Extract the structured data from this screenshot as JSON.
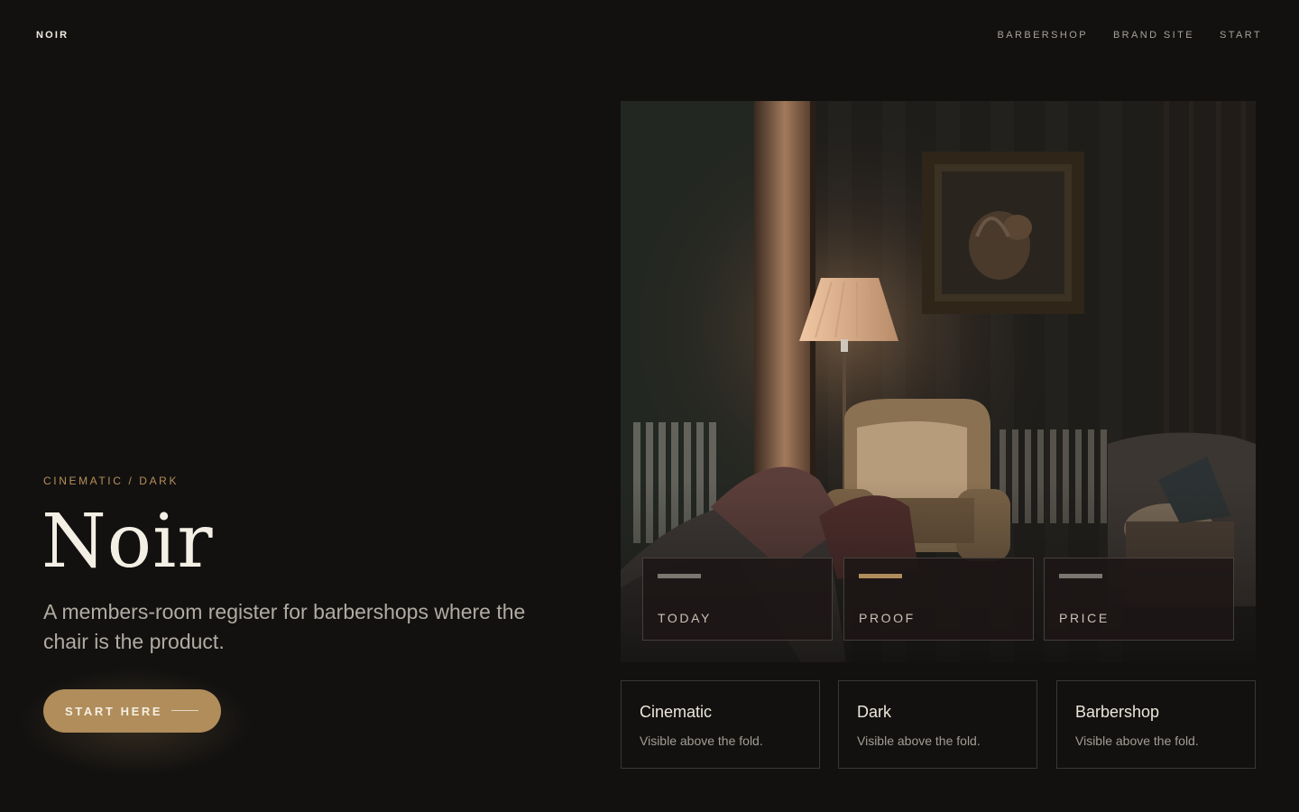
{
  "header": {
    "brand": "NOIR",
    "nav": [
      "BARBERSHOP",
      "BRAND SITE",
      "START"
    ]
  },
  "hero": {
    "eyebrow": "CINEMATIC / DARK",
    "title": "Noir",
    "lede": "A members-room register for barbershops where the chair is the product.",
    "cta_label": "START HERE"
  },
  "image_overlay": {
    "stats": [
      {
        "label": "TODAY",
        "bar_color": "#7a7670"
      },
      {
        "label": "PROOF",
        "bar_color": "#b08d5b"
      },
      {
        "label": "PRICE",
        "bar_color": "#7a7670"
      }
    ]
  },
  "features": [
    {
      "title": "Cinematic",
      "desc": "Visible above the fold."
    },
    {
      "title": "Dark",
      "desc": "Visible above the fold."
    },
    {
      "title": "Barbershop",
      "desc": "Visible above the fold."
    }
  ],
  "colors": {
    "background": "#121110",
    "accent": "#b08d5b",
    "eyebrow": "#b88f58"
  }
}
